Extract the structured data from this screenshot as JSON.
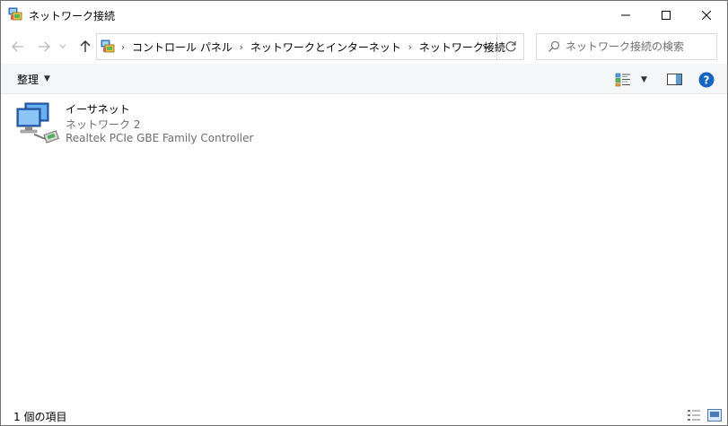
{
  "window": {
    "title": "ネットワーク接続",
    "title_icon": "network-connections-icon",
    "controls": {
      "minimize": "minimize-icon",
      "maximize": "maximize-icon",
      "close": "close-icon"
    }
  },
  "navigation": {
    "back": "arrow-left-icon",
    "forward": "arrow-right-icon",
    "recent": "chevron-down-icon",
    "up": "arrow-up-icon"
  },
  "address": {
    "breadcrumbs": [
      "コントロール パネル",
      "ネットワークとインターネット",
      "ネットワーク接続"
    ],
    "separator": "›"
  },
  "search": {
    "placeholder": "ネットワーク接続の検索"
  },
  "toolbar": {
    "organize_label": "整理"
  },
  "connections": [
    {
      "name": "イーサネット",
      "network": "ネットワーク 2",
      "adapter": "Realtek PCIe GBE Family Controller",
      "icon": "ethernet-adapter-icon"
    }
  ],
  "status": {
    "item_count": "1 個の項目"
  },
  "colors": {
    "accent": "#1e73be",
    "help": "#1565c0",
    "toolbar_bg": "#f5f6f7",
    "secondary_text": "#6d6d6d"
  }
}
